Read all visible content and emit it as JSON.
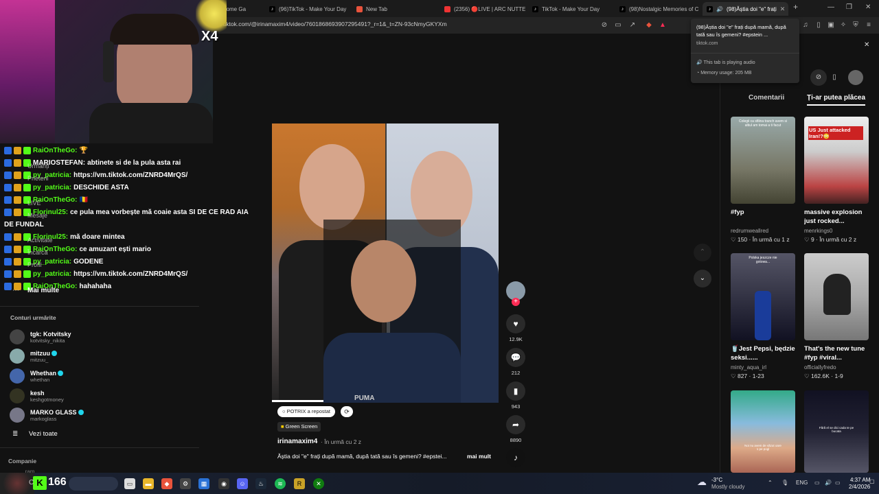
{
  "browser": {
    "tabs": [
      {
        "title": "Godbome Ga",
        "active": false
      },
      {
        "title": "(96)TikTok - Make Your Day",
        "active": false
      },
      {
        "title": "New Tab",
        "active": false
      },
      {
        "title": "(2356) 🔴LIVE | ARC NUTTER",
        "active": false
      },
      {
        "title": "TikTok - Make Your Day",
        "active": false
      },
      {
        "title": "TikTok - Make Your Day",
        "active": false
      },
      {
        "title": "(98)Nostalgic Memories of C",
        "active": false
      },
      {
        "title": "(98)Ăștia doi \"e\" frați",
        "active": true
      }
    ],
    "new_tab": "+",
    "url": "tiktok.com/@irinamaxim4/video/7601868693907295491?_r=1&_t=ZN-93cNmyGKYXm"
  },
  "tooltip": {
    "title": "(98)Ăștia doi \"e\" frați după mamă, după tată sau îs gemeni? #epstein ...",
    "domain": "tiktok.com",
    "audio": "This tab is playing audio",
    "memory": "Memory usage: 205 MB"
  },
  "stream": {
    "multiplier": "X4",
    "chat": [
      {
        "user": "RaiOnTheGo:",
        "user_color": "#53fc18",
        "msg": "🏆",
        "user_label_overlay": ""
      },
      {
        "user": "MARIOSTEFAN:",
        "user_color": "#ffffff",
        "msg": "abtinete si de la pula asta rai",
        "user_label_overlay": "Urmăriți"
      },
      {
        "user": "py_patricia:",
        "user_color": "#53fc18",
        "msg": "https://vm.tiktok.com/ZNRD4MrQS/",
        "user_label_overlay": "Prieteni"
      },
      {
        "user": "py_patricia:",
        "user_color": "#53fc18",
        "msg": "DESCHIDE ASTA",
        "user_label_overlay": ""
      },
      {
        "user": "RaiOnTheGo:",
        "user_color": "#53fc18",
        "msg": "🇷🇴",
        "user_label_overlay": "LIVE"
      },
      {
        "user": "Florinul25:",
        "user_color": "#53fc18",
        "msg": "ce pula mea vorbește mă coaie asta SI DE CE RAD AIA",
        "user_label_overlay": "Mesaje"
      },
      {
        "user": "",
        "user_color": "#ffffff",
        "msg": "DE FUNDAL",
        "user_label_overlay": ""
      },
      {
        "user": "Florinul25:",
        "user_color": "#53fc18",
        "msg": "mă doare mintea",
        "user_label_overlay": "Activitate"
      },
      {
        "user": "RaiOnTheGo:",
        "user_color": "#53fc18",
        "msg": "ce amuzant ești mario",
        "user_label_overlay": "Încarcă"
      },
      {
        "user": "py_patricia:",
        "user_color": "#53fc18",
        "msg": "GODENE",
        "user_label_overlay": "Profil"
      },
      {
        "user": "py_patricia:",
        "user_color": "#53fc18",
        "msg": "https://vm.tiktok.com/ZNRD4MrQS/",
        "user_label_overlay": ""
      },
      {
        "user": "RaiOnTheGo:",
        "user_color": "#53fc18",
        "msg": "hahahaha",
        "user_label_overlay": ""
      }
    ]
  },
  "sidebar": {
    "more": "Mai multe",
    "following_title": "Conturi urmărite",
    "following": [
      {
        "name": "tgk: Kotvitsky",
        "handle": "kotvitsky_nikita",
        "verified": false
      },
      {
        "name": "mitzuu",
        "handle": "mitzuu_",
        "verified": true
      },
      {
        "name": "Whethan",
        "handle": "whethan",
        "verified": true
      },
      {
        "name": "kesh",
        "handle": "keshgotmoney",
        "verified": false
      },
      {
        "name": "MARKO GLASS",
        "handle": "markoglass",
        "verified": true
      }
    ],
    "see_all": "Vezi toate",
    "company": "Companie",
    "partial_text": "...ram"
  },
  "video": {
    "repost_label": "POTRIX a repostat",
    "effect_label": "Green Screen",
    "author": "irinamaxim4",
    "time": "· În urmă cu 2 z",
    "caption": "Ăștia doi \"e\" frați după mamă, după tată sau îs gemeni? #epstei...",
    "more": "mai mult",
    "shirt_text": "PUMA",
    "likes": "12.9K",
    "comments": "212",
    "saves": "943",
    "shares": "8890"
  },
  "right_panel": {
    "tab_comments": "Comentarii",
    "tab_suggested": "Ți-ar putea plăcea",
    "videos": [
      {
        "title": "#fyp",
        "author": "redrumweallred",
        "stats": "♡ 150 · În urmă cu 1 z",
        "thumb_text": "Colegii ca sfilina tranch avem si altiul am tomai a ti facut"
      },
      {
        "title": "massive explosion just rocked...",
        "author": "menrkings0",
        "stats": "♡ 9 · În urmă cu 2 z",
        "thumb_text": "US Just attacked Iran!?😳"
      },
      {
        "title": "🥤Jest Pepsi, będzie seksi......",
        "author": "minty_aqua_irl",
        "stats": "♡ 827 · 1-23",
        "thumb_text": "Polska jeszcze nie gotowa..."
      },
      {
        "title": "That's the new tune #fyp #viral...",
        "author": "officiallyfredo",
        "stats": "♡ 162.6K · 1-9",
        "thumb_text": ""
      },
      {
        "title": "",
        "author": "",
        "stats": "",
        "thumb_text": "Noi nu avem de văzut oare 1 pe pogl"
      },
      {
        "title": "",
        "author": "",
        "stats": "",
        "thumb_text": "Fără el se dici cada te pe bucata"
      }
    ]
  },
  "taskbar": {
    "game_label": "166",
    "search_value": "C",
    "weather_temp": "-3°C",
    "weather_desc": "Mostly cloudy",
    "lang": "ENG",
    "time": "4:37 AM",
    "date": "2/4/2026"
  },
  "colors": {
    "tiktok_red": "#fe2c55",
    "kick_green": "#53fc18",
    "verified_blue": "#20d5ec"
  }
}
